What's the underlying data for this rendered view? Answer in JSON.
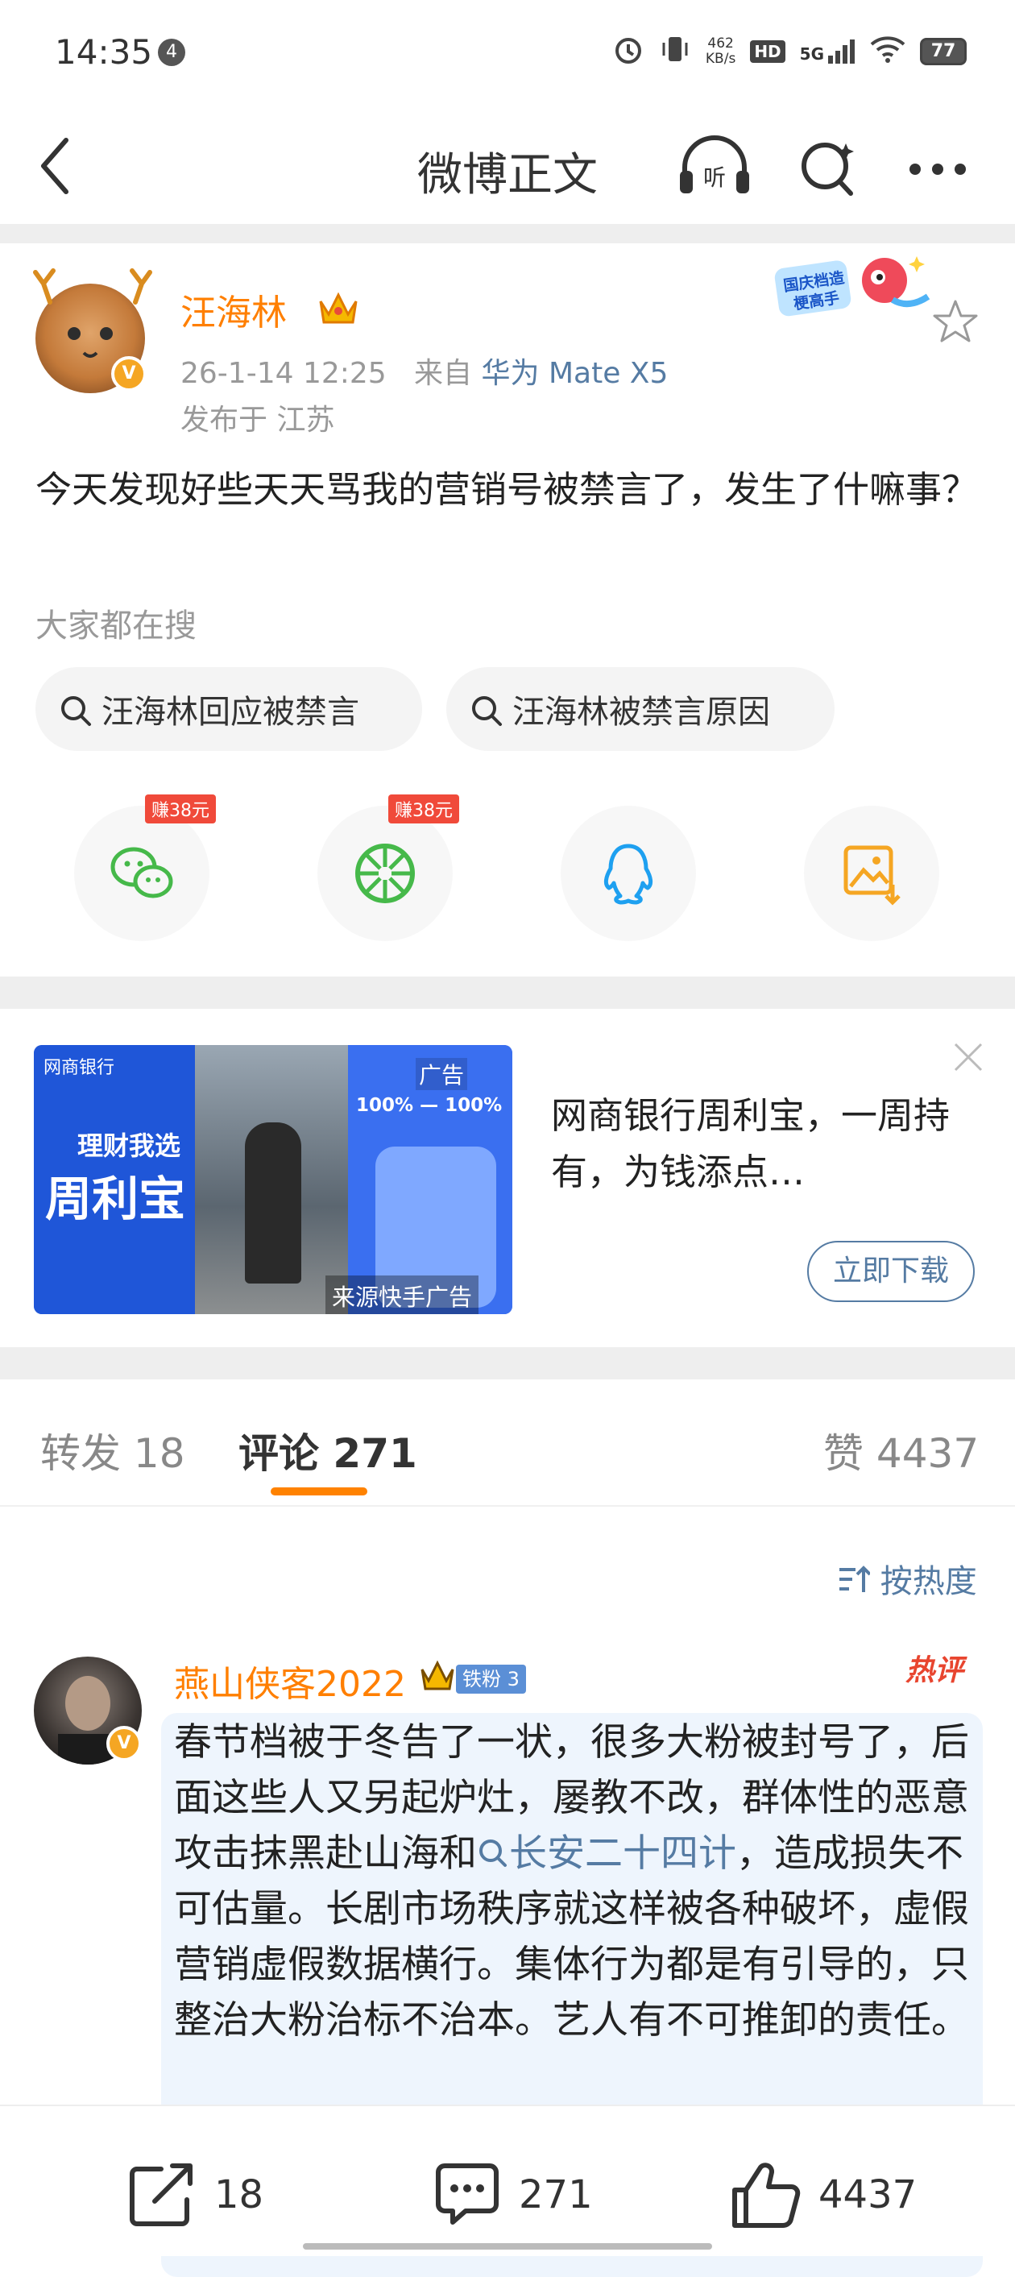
{
  "status_bar": {
    "time": "14:35",
    "notification_count": "4",
    "net_speed_value": "462",
    "net_speed_unit": "KB/s",
    "hd": "HD",
    "signal": "5G",
    "battery": "77"
  },
  "nav": {
    "title": "微博正文"
  },
  "post": {
    "username": "汪海林",
    "badge_text": "国庆档造梗高手",
    "date": "26-1-14 12:25",
    "source_prefix": "来自",
    "source": "华为 Mate X5",
    "location": "发布于 江苏",
    "content": "今天发现好些天天骂我的营销号被禁言了，发生了什嘛事？",
    "search_label": "大家都在搜",
    "searches": [
      "汪海林回应被禁言",
      "汪海林被禁言原因"
    ],
    "share": {
      "wechat_reward": "赚38元",
      "moments_reward": "赚38元"
    }
  },
  "ad": {
    "image_tag": "广告",
    "image_caption": "来源快手广告",
    "image_headline_1": "理财我选",
    "image_headline_2": "周利宝",
    "image_brand": "网商银行",
    "image_stat": "100% — 100%",
    "text": "网商银行周利宝，一周持有，为钱添点…",
    "button": "立即下载"
  },
  "tabs": {
    "repost": "转发 18",
    "comments": "评论 271",
    "likes": "赞 4437"
  },
  "sort_label": "按热度",
  "comment": {
    "username": "燕山侠客2022",
    "fans_badge": "铁粉 3",
    "hot_tag": "热评",
    "text_before": "春节档被于冬告了一状，很多大粉被封号了，后面这些人又另起炉灶，屡教不改，群体性的恶意攻击抹黑赴山海和",
    "link": "长安二十四计",
    "text_after": "，造成损失不可估量。长剧市场秩序就这样被各种破坏，虚假营销虚假数据横行。集体行为都是有引导的，只整治大粉治标不治本。艺人有不可推卸的责任。"
  },
  "bottom_bar": {
    "repost_count": "18",
    "comment_count": "271",
    "like_count": "4437"
  },
  "colors": {
    "orange": "#ff7f00",
    "link_blue": "#557ba3",
    "red": "#e8452f"
  }
}
